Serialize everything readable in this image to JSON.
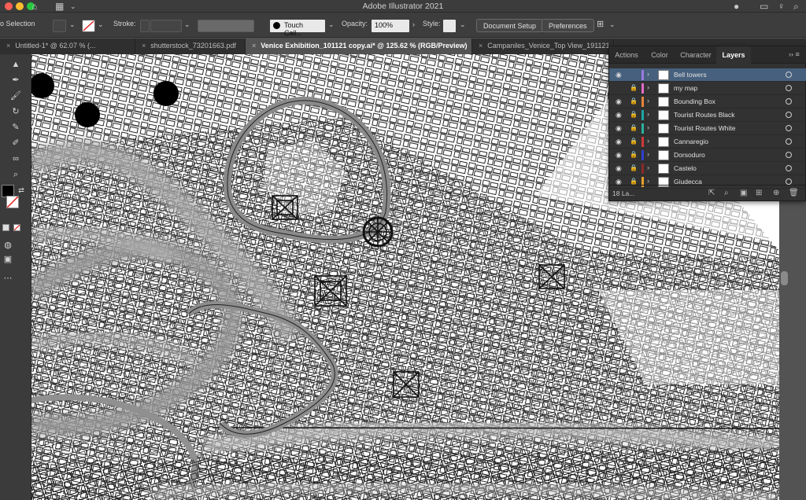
{
  "app": {
    "title": "Adobe Illustrator 2021"
  },
  "colors": {
    "accent_selected": "#46607e",
    "traffic_red": "#fe5f57",
    "traffic_yellow": "#febc2e",
    "traffic_green": "#28c840"
  },
  "control_bar": {
    "selection_label": "o Selection",
    "stroke_label": "Stroke:",
    "brush_label": "Touch Call...",
    "opacity_label": "Opacity:",
    "opacity_value": "100%",
    "style_label": "Style:",
    "document_setup": "Document Setup",
    "preferences": "Preferences"
  },
  "tabs": [
    {
      "label": "Untitled-1* @ 62.07 % (...",
      "active": false
    },
    {
      "label": "shutterstock_73201663.pdf",
      "active": false
    },
    {
      "label": "Venice Exhibition_101121 copy.ai* @ 125.62 % (RGB/Preview)",
      "active": true
    },
    {
      "label": "Campaniles_Venice_Top View_191121",
      "active": false
    }
  ],
  "layers_panel": {
    "tabs": [
      "Actions",
      "Color",
      "Character",
      "Layers"
    ],
    "menu_glyph": "›› ≡",
    "layers": [
      {
        "name": "Bell towers",
        "color": "#9a7ae0",
        "locked": false,
        "visible": true,
        "selected": true
      },
      {
        "name": "my map",
        "color": "#e36ac7",
        "locked": true,
        "visible": false,
        "selected": false
      },
      {
        "name": "Bounding Box",
        "color": "#e8843a",
        "locked": true,
        "visible": true,
        "selected": false
      },
      {
        "name": "Tourist Routes Black",
        "color": "#1aa6a6",
        "locked": true,
        "visible": true,
        "selected": false
      },
      {
        "name": "Tourist Routes White",
        "color": "#2bb0a0",
        "locked": true,
        "visible": true,
        "selected": false
      },
      {
        "name": "Cannaregio",
        "color": "#d13a3a",
        "locked": true,
        "visible": true,
        "selected": false
      },
      {
        "name": "Dorsoduro",
        "color": "#2f3fd0",
        "locked": true,
        "visible": true,
        "selected": false
      },
      {
        "name": "Castelo",
        "color": "#8a2a2a",
        "locked": true,
        "visible": true,
        "selected": false
      },
      {
        "name": "Giudecca",
        "color": "#e8a02a",
        "locked": true,
        "visible": true,
        "selected": false
      }
    ],
    "count_label": "18 La..."
  }
}
